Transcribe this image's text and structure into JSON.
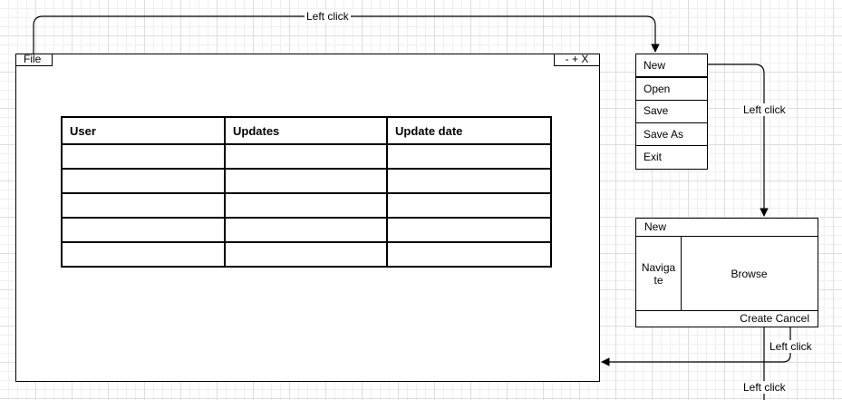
{
  "window": {
    "file_menu_label": "File",
    "window_controls": "- + X"
  },
  "table": {
    "headers": [
      "User",
      "Updates",
      "Update date"
    ],
    "rows": [
      [
        "",
        "",
        ""
      ],
      [
        "",
        "",
        ""
      ],
      [
        "",
        "",
        ""
      ],
      [
        "",
        "",
        ""
      ],
      [
        "",
        "",
        ""
      ]
    ]
  },
  "file_menu": {
    "items": [
      "New",
      "Open",
      "Save",
      "Save As",
      "Exit"
    ]
  },
  "new_dialog": {
    "title": "New",
    "navigate_label": "Navigate",
    "browse_label": "Browse",
    "footer_buttons": "Create Cancel"
  },
  "edge_labels": {
    "file_to_menu": "Left click",
    "new_to_dialog": "Left click",
    "create_to_window": "Left click",
    "cancel_down": "Left click"
  }
}
